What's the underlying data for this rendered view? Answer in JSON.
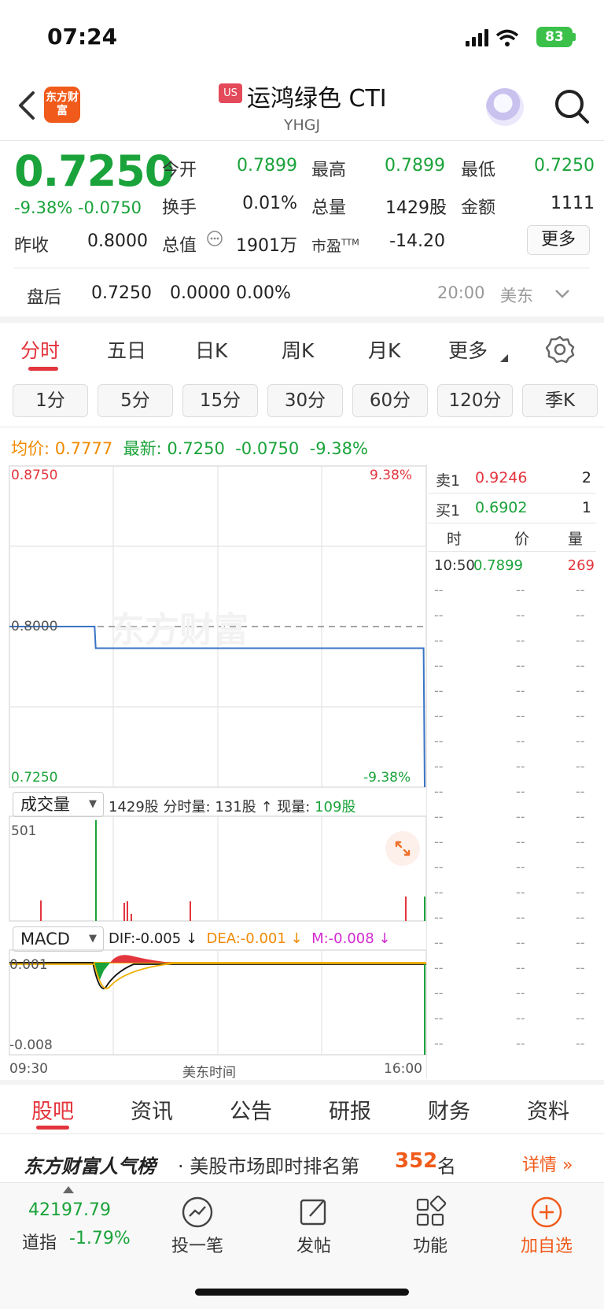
{
  "status_bar": {
    "time": "07:24",
    "battery": "83"
  },
  "header": {
    "market_badge": "US",
    "name": "运鸿绿色 CTI",
    "code": "YHGJ",
    "logo_text": "东方财富"
  },
  "quote": {
    "price": "0.7250",
    "change_pct": "-9.38%",
    "change_abs": "-0.0750",
    "fields": [
      {
        "label": "今开",
        "value": "0.7899",
        "color": "green"
      },
      {
        "label": "最高",
        "value": "0.7899",
        "color": "green"
      },
      {
        "label": "最低",
        "value": "0.7250",
        "color": "green"
      },
      {
        "label": "换手",
        "value": "0.01%",
        "color": "black"
      },
      {
        "label": "总量",
        "value": "1429股",
        "color": "black"
      },
      {
        "label": "金额",
        "value": "1111",
        "color": "black"
      },
      {
        "label": "昨收",
        "value": "0.8000",
        "color": "black"
      },
      {
        "label": "总值",
        "value": "1901万",
        "color": "black"
      },
      {
        "label": "市盈",
        "label_sup": "TTM",
        "value": "-14.20",
        "color": "black"
      }
    ],
    "more_label": "更多"
  },
  "after_hours": {
    "label": "盘后",
    "price": "0.7250",
    "change": "0.0000",
    "pct": "0.00%",
    "time": "20:00",
    "zone": "美东"
  },
  "period_tabs": [
    "分时",
    "五日",
    "日K",
    "周K",
    "月K",
    "更多"
  ],
  "active_period_tab": 0,
  "kline_tabs": [
    "1分",
    "5分",
    "15分",
    "30分",
    "60分",
    "120分",
    "季K"
  ],
  "price_info": {
    "avg_label": "均价:",
    "avg": "0.7777",
    "latest_label": "最新:",
    "latest": "0.7250",
    "change": "-0.0750",
    "pct": "-9.38%"
  },
  "chart": {
    "y_top": "0.8750",
    "y_top_pct": "9.38%",
    "y_mid": "0.8000",
    "y_bottom": "0.7250",
    "y_bottom_pct": "-9.38%",
    "watermark": "东方财富",
    "volume": {
      "selector": "成交量",
      "total": "1429股",
      "fen_label": "分时量:",
      "fen_value": "131股",
      "now_label": "现量:",
      "now_value": "109股",
      "y_max": "501"
    },
    "macd": {
      "selector": "MACD",
      "dif": "DIF:-0.005",
      "dea": "DEA:-0.001",
      "m": "M:-0.008",
      "y_top": "0.001",
      "y_bottom": "-0.008"
    },
    "x_labels": {
      "start": "09:30",
      "mid": "美东时间",
      "end": "16:00"
    }
  },
  "order_book": {
    "sell1": {
      "label": "卖1",
      "price": "0.9246",
      "qty": "2"
    },
    "buy1": {
      "label": "买1",
      "price": "0.6902",
      "qty": "1"
    },
    "headers": [
      "时",
      "价",
      "量"
    ],
    "first_trade": {
      "time": "10:50",
      "price": "0.7899",
      "qty": "269"
    },
    "placeholder": "--"
  },
  "bottom_tabs": [
    "股吧",
    "资讯",
    "公告",
    "研报",
    "财务",
    "资料"
  ],
  "rank": {
    "brand": "东方财富人气榜",
    "text": "· 美股市场即时排名第",
    "rank": "352",
    "suffix": "名",
    "detail": "详情 »"
  },
  "bottom_nav": {
    "index_value": "42197.79",
    "index_name": "道指",
    "index_pct": "-1.79%",
    "items": [
      "投一笔",
      "发帖",
      "功能",
      "加自选"
    ]
  },
  "chart_data": {
    "type": "line",
    "y_range": [
      0.725,
      0.875
    ],
    "prev_close": 0.8,
    "series": [
      {
        "x": [
          "09:30",
          "10:50",
          "10:51",
          "15:59",
          "16:00"
        ],
        "values": [
          0.8,
          0.8,
          0.7899,
          0.7899,
          0.725
        ]
      }
    ]
  }
}
